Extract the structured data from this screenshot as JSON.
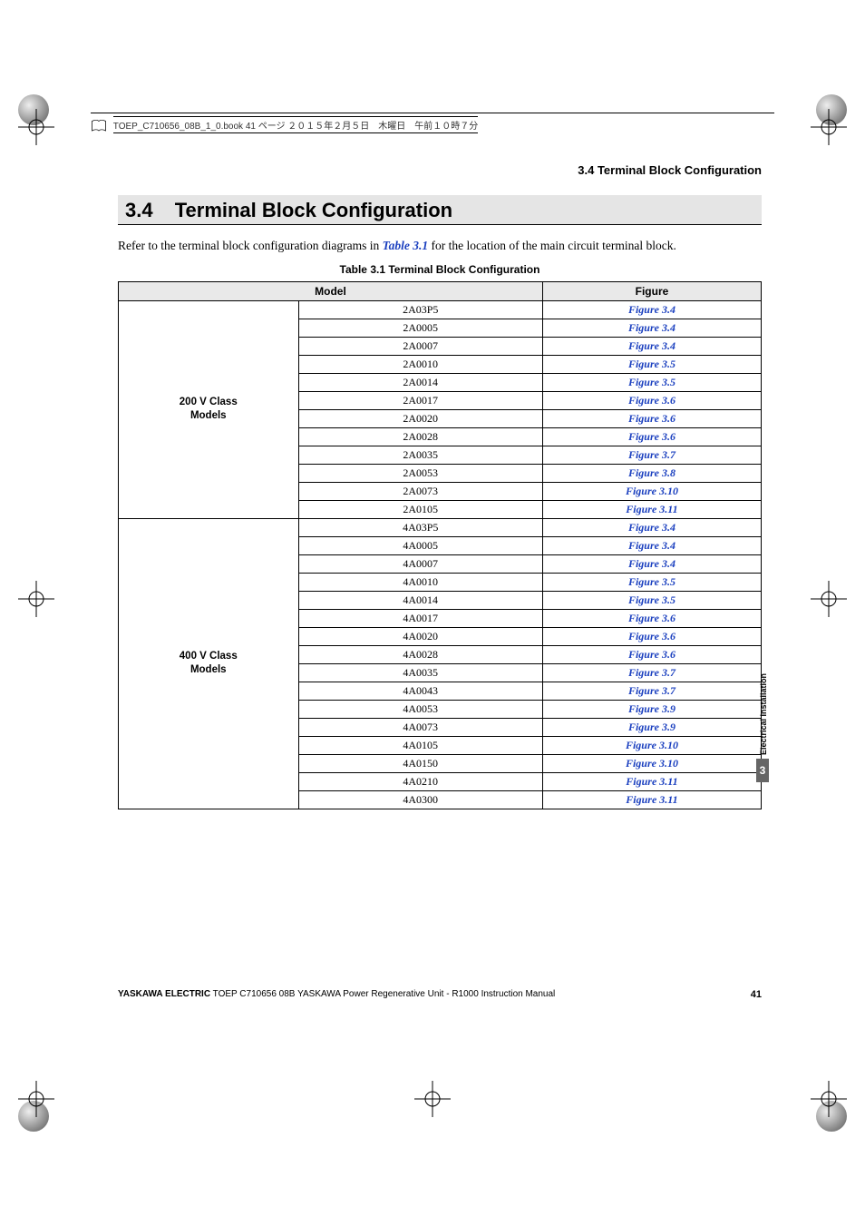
{
  "running_header": "3.4  Terminal Block Configuration",
  "section": {
    "number": "3.4",
    "title": "Terminal Block Configuration"
  },
  "intro_prefix": "Refer to the terminal block configuration diagrams in ",
  "intro_ref": "Table 3.1",
  "intro_suffix": " for the location of the main circuit terminal block.",
  "table_caption": "Table 3.1  Terminal Block Configuration",
  "table": {
    "headers": {
      "model": "Model",
      "figure": "Figure"
    },
    "groups": [
      {
        "label": "200 V Class\nModels",
        "rows": [
          {
            "model": "2A03P5",
            "figure": "Figure 3.4"
          },
          {
            "model": "2A0005",
            "figure": "Figure 3.4"
          },
          {
            "model": "2A0007",
            "figure": "Figure 3.4"
          },
          {
            "model": "2A0010",
            "figure": "Figure 3.5"
          },
          {
            "model": "2A0014",
            "figure": "Figure 3.5"
          },
          {
            "model": "2A0017",
            "figure": "Figure 3.6"
          },
          {
            "model": "2A0020",
            "figure": "Figure 3.6"
          },
          {
            "model": "2A0028",
            "figure": "Figure 3.6"
          },
          {
            "model": "2A0035",
            "figure": "Figure 3.7"
          },
          {
            "model": "2A0053",
            "figure": "Figure 3.8"
          },
          {
            "model": "2A0073",
            "figure": "Figure 3.10"
          },
          {
            "model": "2A0105",
            "figure": "Figure 3.11"
          }
        ]
      },
      {
        "label": "400 V Class\nModels",
        "rows": [
          {
            "model": "4A03P5",
            "figure": "Figure 3.4"
          },
          {
            "model": "4A0005",
            "figure": "Figure 3.4"
          },
          {
            "model": "4A0007",
            "figure": "Figure 3.4"
          },
          {
            "model": "4A0010",
            "figure": "Figure 3.5"
          },
          {
            "model": "4A0014",
            "figure": "Figure 3.5"
          },
          {
            "model": "4A0017",
            "figure": "Figure 3.6"
          },
          {
            "model": "4A0020",
            "figure": "Figure 3.6"
          },
          {
            "model": "4A0028",
            "figure": "Figure 3.6"
          },
          {
            "model": "4A0035",
            "figure": "Figure 3.7"
          },
          {
            "model": "4A0043",
            "figure": "Figure 3.7"
          },
          {
            "model": "4A0053",
            "figure": "Figure 3.9"
          },
          {
            "model": "4A0073",
            "figure": "Figure 3.9"
          },
          {
            "model": "4A0105",
            "figure": "Figure 3.10"
          },
          {
            "model": "4A0150",
            "figure": "Figure 3.10"
          },
          {
            "model": "4A0210",
            "figure": "Figure 3.11"
          },
          {
            "model": "4A0300",
            "figure": "Figure 3.11"
          }
        ]
      }
    ]
  },
  "side_tab": {
    "label": "Electrical Installation",
    "chapter": "3"
  },
  "footer": {
    "brand": "YASKAWA ELECTRIC",
    "doc": " TOEP C710656 08B YASKAWA Power Regenerative Unit - R1000 Instruction Manual",
    "page": "41"
  },
  "book_header": "TOEP_C710656_08B_1_0.book  41 ページ  ２０１５年２月５日　木曜日　午前１０時７分"
}
